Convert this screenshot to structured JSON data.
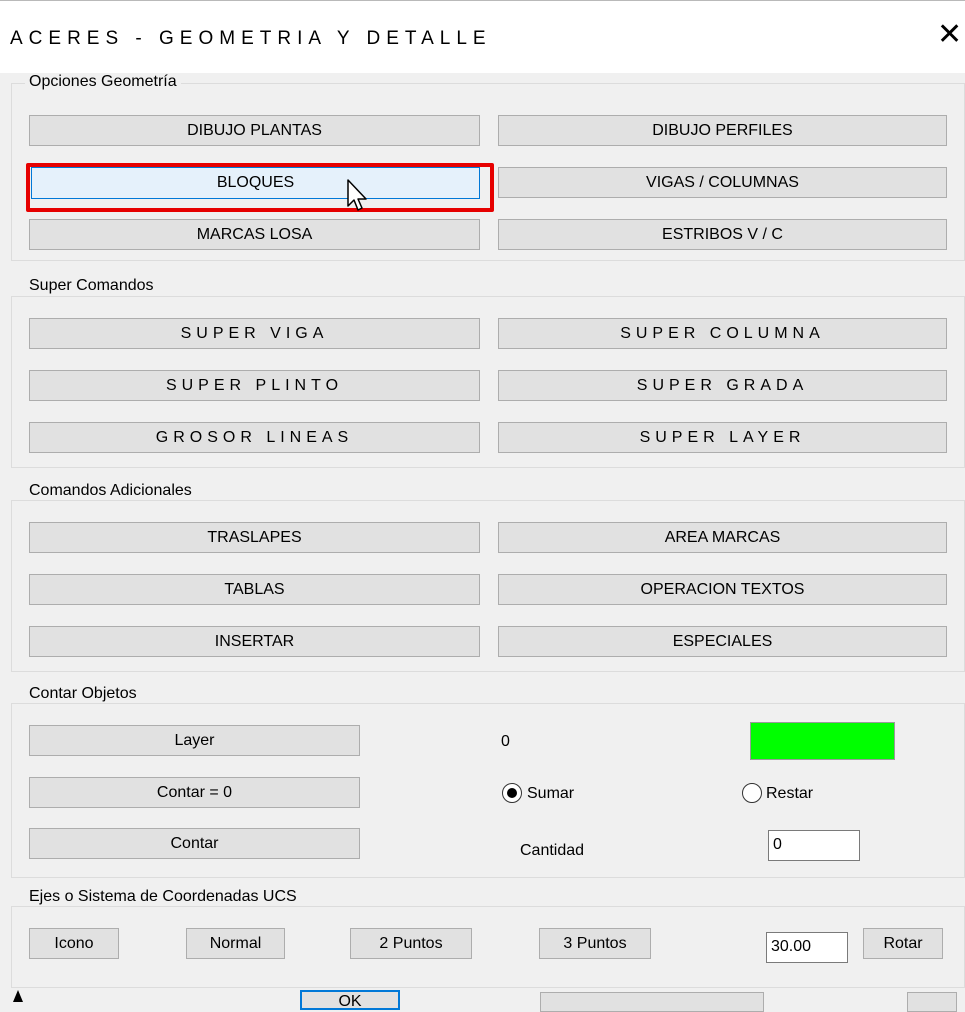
{
  "window": {
    "title": "ACERES - GEOMETRIA Y DETALLE",
    "close_symbol": "✕"
  },
  "geometria": {
    "legend": "Opciones Geometría",
    "buttons": [
      "DIBUJO PLANTAS",
      "DIBUJO PERFILES",
      "BLOQUES",
      "VIGAS / COLUMNAS",
      "MARCAS LOSA",
      "ESTRIBOS V / C"
    ]
  },
  "super": {
    "legend": "Super Comandos",
    "buttons": [
      "SUPER VIGA",
      "SUPER COLUMNA",
      "SUPER PLINTO",
      "SUPER GRADA",
      "GROSOR LINEAS",
      "SUPER LAYER"
    ]
  },
  "adicionales": {
    "legend": "Comandos Adicionales",
    "buttons": [
      "TRASLAPES",
      "AREA MARCAS",
      "TABLAS",
      "OPERACION TEXTOS",
      "INSERTAR",
      "ESPECIALES"
    ]
  },
  "contar": {
    "legend": "Contar Objetos",
    "layer_button": "Layer",
    "reset_button": "Contar = 0",
    "count_button": "Contar",
    "count_value": "0",
    "swatch_color": "#00ff00",
    "sumar_label": "Sumar",
    "restar_label": "Restar",
    "sumar_selected": true,
    "cantidad_label": "Cantidad",
    "cantidad_value": "0"
  },
  "ucs": {
    "legend": "Ejes o Sistema de Coordenadas UCS",
    "icono_button": "Icono",
    "normal_button": "Normal",
    "dos_puntos_button": "2 Puntos",
    "tres_puntos_button": "3 Puntos",
    "angle_value": "30.00",
    "rotar_button": "Rotar"
  },
  "footer": {
    "ok_button": "OK"
  },
  "colors": {
    "highlight": "#e60000",
    "selected_border": "#0078d7",
    "selected_bg": "#e5f1fb"
  }
}
